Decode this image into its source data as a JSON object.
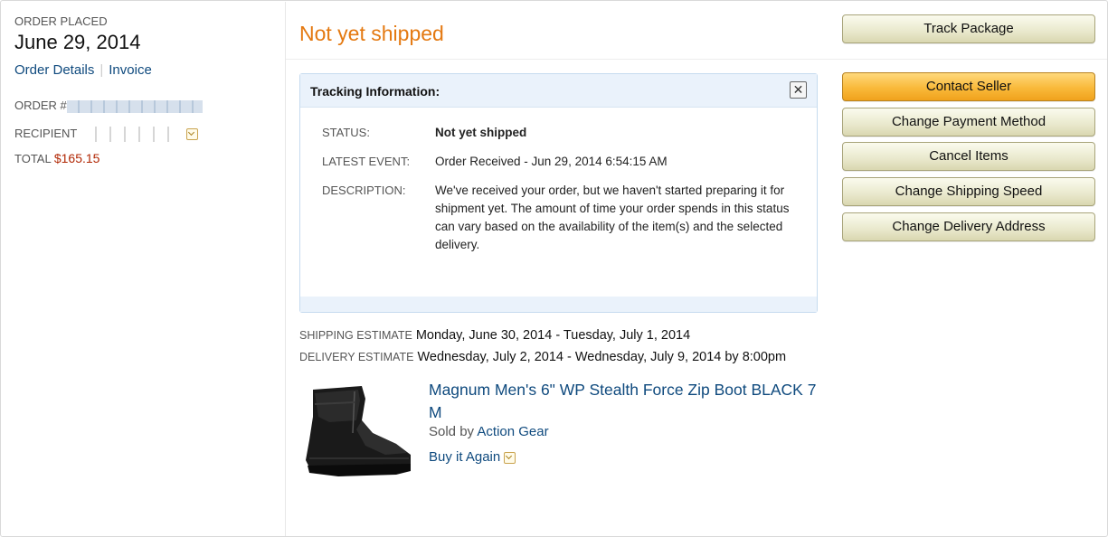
{
  "order": {
    "placed_label": "ORDER PLACED",
    "date": "June 29, 2014",
    "details_link": "Order Details",
    "separator": "|",
    "invoice_link": "Invoice",
    "order_num_label": "ORDER #",
    "recipient_label": "RECIPIENT",
    "total_label": "TOTAL",
    "total_value": "$165.15"
  },
  "status": {
    "headline": "Not yet shipped",
    "headline_color": "#e47911"
  },
  "tracking": {
    "title": "Tracking Information:",
    "close_glyph": "✕",
    "rows": [
      {
        "label": "STATUS:",
        "value": "Not yet shipped"
      },
      {
        "label": "LATEST EVENT:",
        "value": "Order Received - Jun 29, 2014 6:54:15 AM"
      },
      {
        "label": "DESCRIPTION:",
        "value": "We've received your order, but we haven't started preparing it for shipment yet. The amount of time your order spends in this status can vary based on the availability of the item(s) and the selected delivery."
      }
    ]
  },
  "estimates": {
    "shipping_label": "SHIPPING ESTIMATE",
    "shipping_value": "Monday, June 30, 2014 - Tuesday, July 1, 2014",
    "delivery_label": "DELIVERY ESTIMATE",
    "delivery_value": "Wednesday, July 2, 2014 - Wednesday, July 9, 2014 by 8:00pm"
  },
  "product": {
    "title": "Magnum Men's 6\" WP Stealth Force Zip Boot BLACK 7 M",
    "sold_by_label": "Sold by",
    "seller": "Action Gear",
    "buy_again": "Buy it Again",
    "image_icon": "boot-icon"
  },
  "actions": {
    "track_package": "Track Package",
    "contact_seller": "Contact Seller",
    "change_payment": "Change Payment Method",
    "cancel_items": "Cancel Items",
    "change_shipping": "Change Shipping Speed",
    "change_address": "Change Delivery Address"
  },
  "colors": {
    "link": "#0f4a7e",
    "price": "#b12704",
    "primary_button": "#f9b93a",
    "secondary_button": "#e9e8cc"
  }
}
